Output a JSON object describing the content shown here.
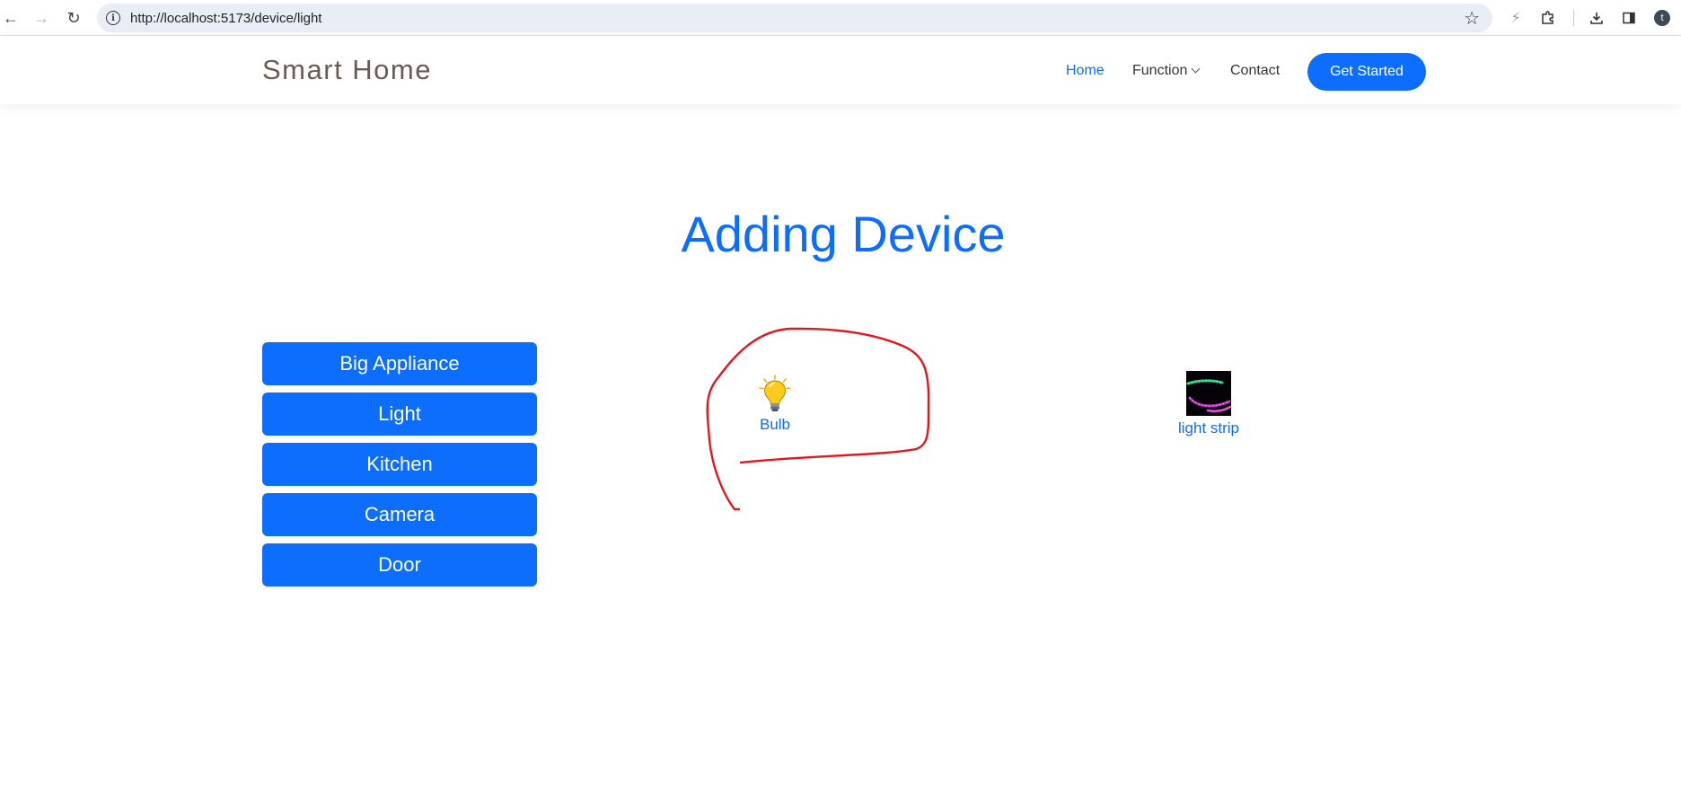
{
  "browser": {
    "url": "http://localhost:5173/device/light",
    "profile_initial": "t"
  },
  "header": {
    "brand": "Smart Home",
    "nav": {
      "home": "Home",
      "function": "Function",
      "contact": "Contact"
    },
    "cta": "Get Started"
  },
  "main": {
    "title": "Adding Device",
    "categories": [
      {
        "label": "Big Appliance"
      },
      {
        "label": "Light"
      },
      {
        "label": "Kitchen"
      },
      {
        "label": "Camera"
      },
      {
        "label": "Door"
      }
    ],
    "devices": [
      {
        "label": "Bulb",
        "icon": "lightbulb-icon"
      },
      {
        "label": "light strip",
        "icon": "led-strip-thumbnail"
      }
    ]
  },
  "colors": {
    "primary": "#0d6efd",
    "brand_text": "#6b5b55",
    "annotation": "#e8141b"
  }
}
